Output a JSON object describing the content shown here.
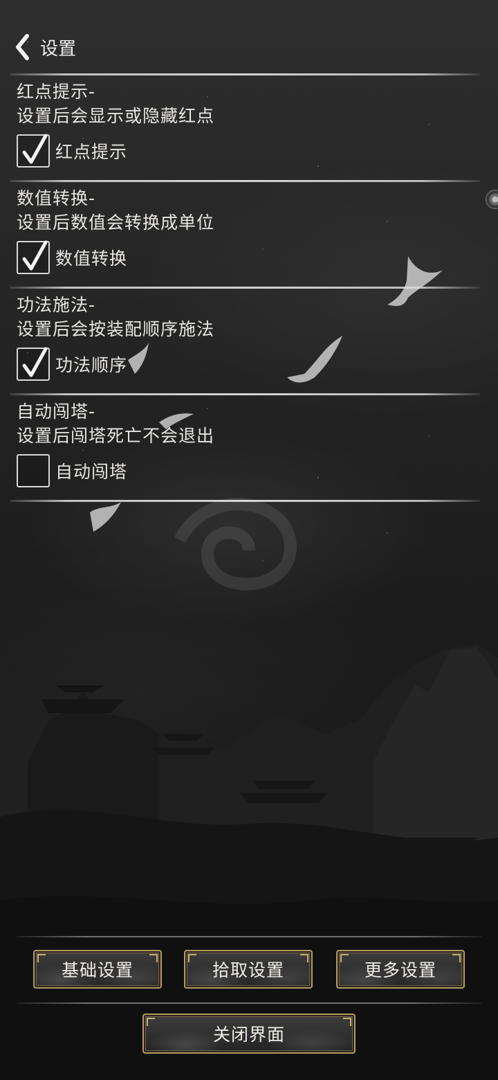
{
  "header": {
    "title": "设置",
    "back_icon": "chevron-left-icon"
  },
  "sections": [
    {
      "title": "红点提示-",
      "description": "设置后会显示或隐藏红点",
      "checkbox_label": "红点提示",
      "checked": true
    },
    {
      "title": "数值转换-",
      "description": "设置后数值会转换成单位",
      "checkbox_label": "数值转换",
      "checked": true
    },
    {
      "title": "功法施法-",
      "description": "设置后会按装配顺序施法",
      "checkbox_label": "功法顺序",
      "checked": true
    },
    {
      "title": "自动闯塔-",
      "description": "设置后闯塔死亡不会退出",
      "checkbox_label": "自动闯塔",
      "checked": false
    }
  ],
  "buttons": {
    "basic": "基础设置",
    "pickup": "拾取设置",
    "more": "更多设置",
    "close": "关闭界面"
  },
  "colors": {
    "accent_gold": "#b39a66",
    "text": "#e8e6e2",
    "background": "#1d1d1d"
  }
}
